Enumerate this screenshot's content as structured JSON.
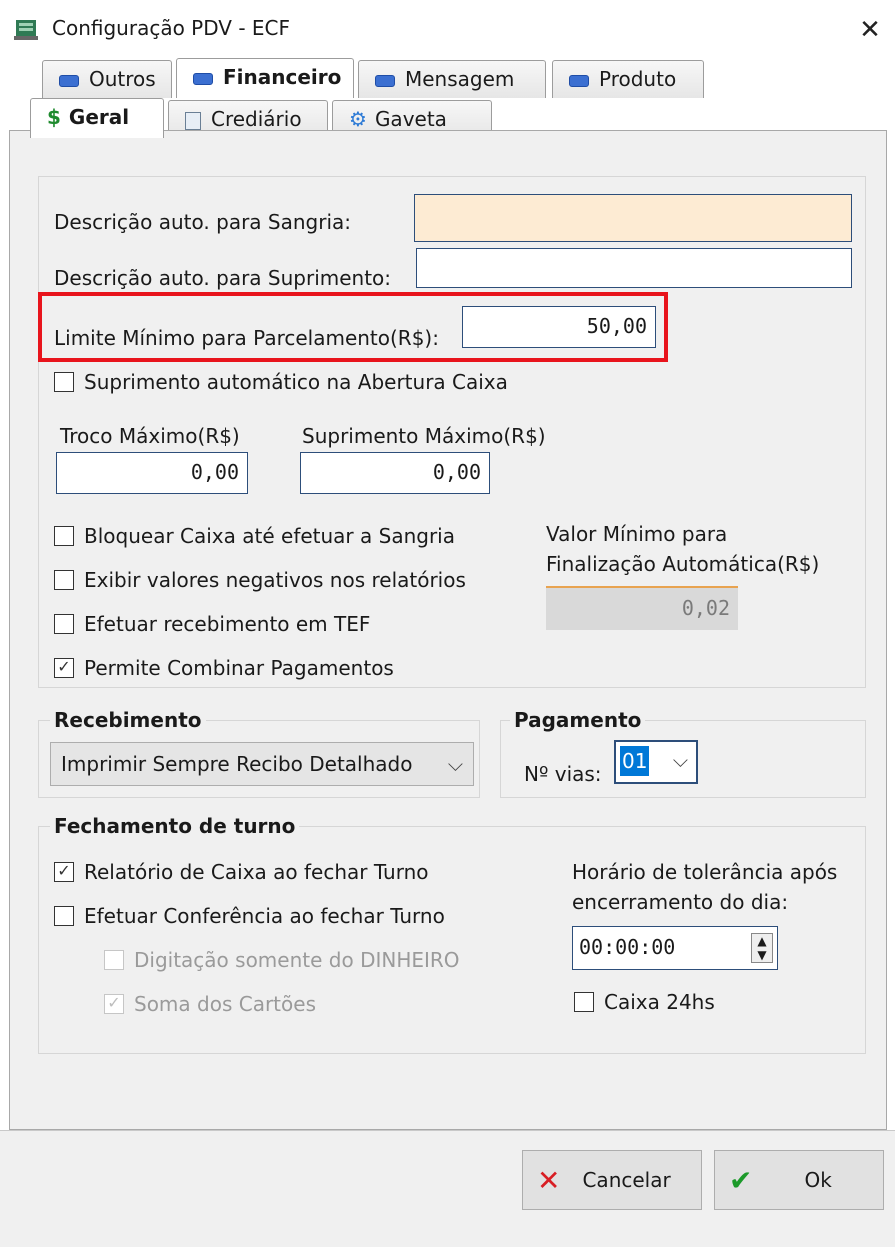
{
  "window": {
    "title": "Configuração PDV - ECF",
    "close_glyph": "✕"
  },
  "tabs_top": [
    "Outros",
    "Financeiro",
    "Mensagem",
    "Produto"
  ],
  "tabs_sub": [
    "Geral",
    "Crediário",
    "Gaveta"
  ],
  "geral": {
    "sangria_label": "Descrição auto. para Sangria:",
    "sangria_value": "",
    "suprimento_label": "Descrição auto. para Suprimento:",
    "suprimento_value": "",
    "limite_label": "Limite Mínimo para Parcelamento(R$):",
    "limite_value": "50,00",
    "suprimento_auto_label": "Suprimento automático na Abertura Caixa",
    "troco_label": "Troco Máximo(R$)",
    "troco_value": "0,00",
    "suprimento_max_label": "Suprimento Máximo(R$)",
    "suprimento_max_value": "0,00",
    "bloquear_label": "Bloquear Caixa até efetuar a Sangria",
    "exibir_label": "Exibir valores negativos nos relatórios",
    "tef_label": "Efetuar recebimento em TEF",
    "combinar_label": "Permite Combinar Pagamentos",
    "valor_min_label_1": "Valor Mínimo para",
    "valor_min_label_2": "Finalização Automática(R$)",
    "valor_min_value": "0,02"
  },
  "recebimento": {
    "title": "Recebimento",
    "selected": "Imprimir Sempre Recibo Detalhado"
  },
  "pagamento": {
    "title": "Pagamento",
    "vias_label": "Nº vias:",
    "vias_value": "01"
  },
  "fechamento": {
    "title": "Fechamento de turno",
    "relatorio_label": "Relatório de Caixa ao fechar Turno",
    "conferencia_label": "Efetuar Conferência ao fechar Turno",
    "digitacao_label": "Digitação somente do DINHEIRO",
    "soma_label": "Soma dos Cartões",
    "horario_label_1": "Horário de tolerância após",
    "horario_label_2": "encerramento do dia:",
    "horario_value": "00:00:00",
    "caixa24_label": "Caixa 24hs"
  },
  "buttons": {
    "cancelar": "Cancelar",
    "ok": "Ok"
  },
  "colors": {
    "highlight": "#e8141c",
    "sangria_bg": "#fdebd3",
    "accent": "#2d4e7a"
  }
}
